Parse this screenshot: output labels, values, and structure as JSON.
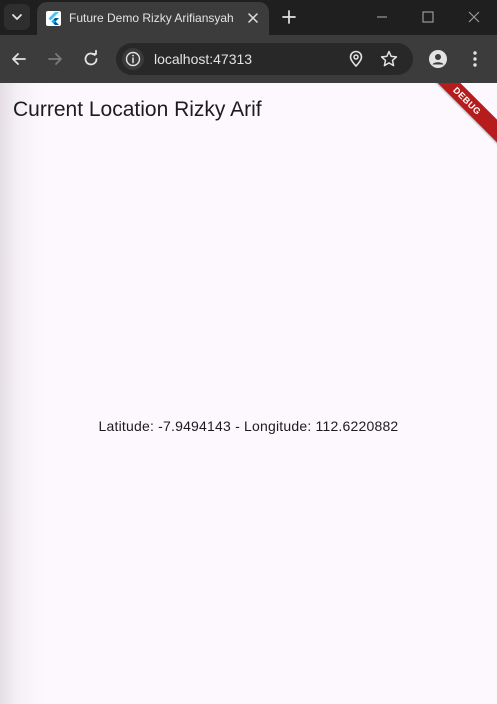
{
  "browser": {
    "tab": {
      "title": "Future Demo Rizky Arifiansyah",
      "favicon": "flutter-icon"
    },
    "address_bar": {
      "url": "localhost:47313"
    },
    "icons": {
      "tab_search": "chevron-down-icon",
      "tab_close": "close-icon",
      "new_tab": "plus-icon",
      "minimize": "minimize-icon",
      "maximize": "maximize-icon",
      "window_close": "close-icon",
      "back": "arrow-left-icon",
      "forward": "arrow-right-icon",
      "reload": "reload-icon",
      "site_info": "info-icon",
      "location": "location-pin-icon",
      "bookmark": "star-icon",
      "profile": "person-icon",
      "menu": "more-vert-icon"
    }
  },
  "app": {
    "title": "Current Location Rizky Arif",
    "location_text": "Latitude: -7.9494143 - Longitude: 112.6220882",
    "debug_banner": "DEBUG"
  },
  "colors": {
    "page_background": "#fdf7fe",
    "debug_banner": "#b71c1c",
    "chrome_dark": "#1f1f1f",
    "toolbar": "#3c3c3c"
  }
}
